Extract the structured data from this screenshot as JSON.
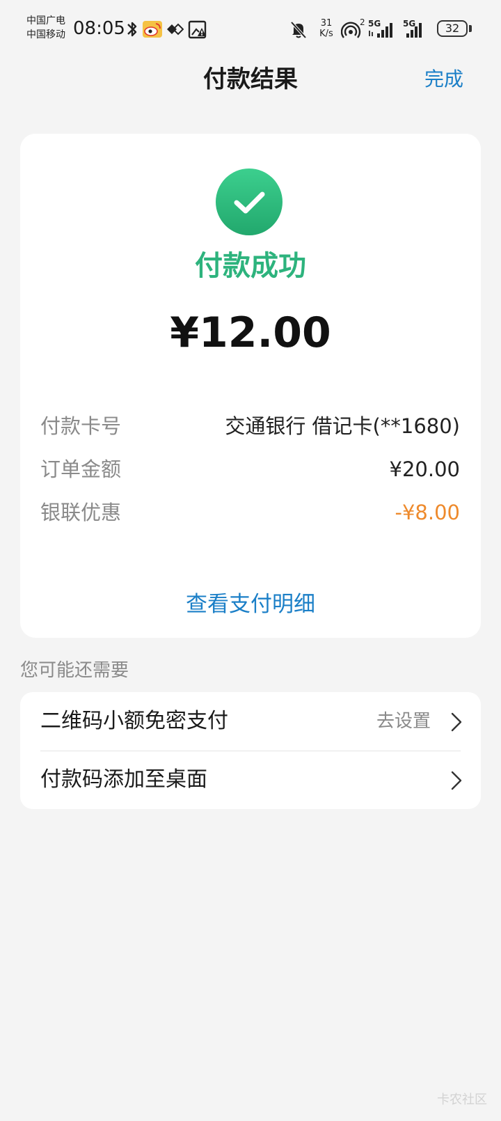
{
  "status_bar": {
    "carrier_1": "中国广电",
    "carrier_2": "中国移动",
    "time": "08:05",
    "net_speed_value": "31",
    "net_speed_unit": "K/s",
    "hotspot_count": "2",
    "signal_1_label": "5G",
    "signal_2_label": "5G",
    "battery": "32",
    "icons": [
      "bluetooth-icon",
      "weibo-icon",
      "diamond-app-icon",
      "image-alert-icon",
      "mute-bell-icon",
      "hotspot-icon",
      "signal-5g-icon",
      "signal-5g-icon",
      "battery-icon"
    ]
  },
  "header": {
    "title": "付款结果",
    "done_label": "完成"
  },
  "result": {
    "status_text": "付款成功",
    "amount": "¥12.00",
    "accent_color": "#2db37d",
    "rows": [
      {
        "label": "付款卡号",
        "value": "交通银行 借记卡(**1680)"
      },
      {
        "label": "订单金额",
        "value": "¥20.00"
      },
      {
        "label": "银联优惠",
        "value": "-¥8.00"
      }
    ],
    "details_link": "查看支付明细"
  },
  "suggestions": {
    "title": "您可能还需要",
    "items": [
      {
        "label": "二维码小额免密支付",
        "action": "去设置"
      },
      {
        "label": "付款码添加至桌面",
        "action": ""
      }
    ]
  },
  "watermark": "卡农社区",
  "colors": {
    "link": "#1b7fc7",
    "discount": "#ee8a2c",
    "background": "#f4f4f4"
  }
}
